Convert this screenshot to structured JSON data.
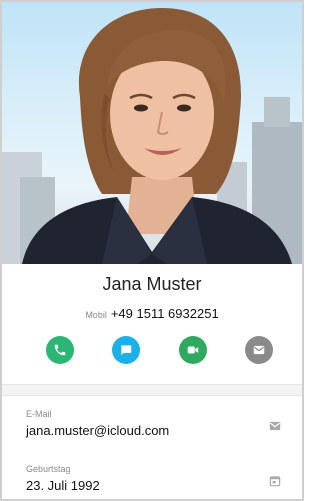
{
  "contact": {
    "name": "Jana Muster",
    "phone_label": "Mobil",
    "phone": "+49 1511 6932251"
  },
  "actions": [
    {
      "name": "call",
      "icon": "phone-icon",
      "color": "#2bb673"
    },
    {
      "name": "message",
      "icon": "chat-icon",
      "color": "#1ab0e8"
    },
    {
      "name": "video",
      "icon": "video-call-icon",
      "color": "#2fa95f"
    },
    {
      "name": "email",
      "icon": "mail-icon",
      "color": "#8a8a8a"
    }
  ],
  "details": {
    "email": {
      "label": "E-Mail",
      "value": "jana.muster@icloud.com",
      "icon": "mail-icon"
    },
    "birthday": {
      "label": "Geburtstag",
      "value": "23. Juli 1992",
      "icon": "calendar-icon"
    }
  }
}
